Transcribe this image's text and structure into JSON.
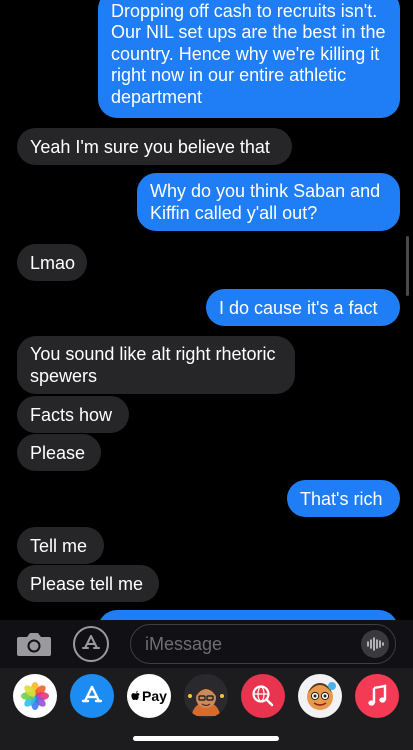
{
  "messages": [
    {
      "from": "me",
      "text": "Dropping off cash to recruits isn't. Our NIL set ups are the best in the country. Hence why we're killing it right now in our entire athletic department"
    },
    {
      "from": "them",
      "text": "Yeah I'm sure you believe that"
    },
    {
      "from": "me",
      "text": "Why do you think Saban and Kiffin called y'all out?"
    },
    {
      "from": "them",
      "text": "Lmao"
    },
    {
      "from": "me",
      "text": "I do cause it's a fact"
    },
    {
      "from": "them",
      "text": "You sound like alt right rhetoric spewers"
    },
    {
      "from": "them",
      "text": "Facts how"
    },
    {
      "from": "them",
      "text": "Please"
    },
    {
      "from": "me",
      "text": "That's rich"
    },
    {
      "from": "them",
      "text": "Tell me"
    },
    {
      "from": "them",
      "text": "Please tell me"
    }
  ],
  "composer": {
    "placeholder": "iMessage",
    "camera_icon": "camera-icon",
    "apps_icon": "app-store-icon",
    "audio_icon": "audio-waveform-icon"
  },
  "app_drawer": {
    "apple_pay_label": "Pay",
    "apps": [
      "photos",
      "app-store",
      "apple-pay",
      "memoji",
      "web-search",
      "stickers",
      "animoji",
      "music"
    ]
  },
  "colors": {
    "sent_bubble": "#1f7ef6",
    "received_bubble": "#262628",
    "background": "#000000"
  }
}
